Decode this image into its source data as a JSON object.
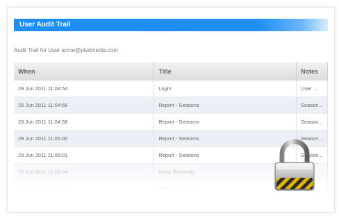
{
  "panel": {
    "title": "User Audit Trail"
  },
  "subtitle": "Audit Trail for User acme@pivdmedia.com",
  "table": {
    "headers": [
      "When",
      "Title",
      "Notes"
    ],
    "rows": [
      [
        "29 Jun 2011 11:04:54",
        "Login",
        "User ..."
      ],
      [
        "29 Jun 2011 11:04:56",
        "Report - Seasons",
        "Season..."
      ],
      [
        "29 Jun 2011 11:04:58",
        "Report - Seasons",
        "Season..."
      ],
      [
        "29 Jun 2011 11:05:00",
        "Report - Seasons",
        "Season..."
      ],
      [
        "29 Jun 2011 11:05:01",
        "Report - Seasons",
        "Season..."
      ],
      [
        "29 Jun 2011 11:05:04",
        "Kiosk Summary",
        ""
      ],
      [
        "29 Jun 2011 11:05:07",
        "Report - User List",
        ""
      ]
    ]
  },
  "icons": {
    "lock": "padlock-icon"
  },
  "colors": {
    "title_bar": "#1e8ef7",
    "row_alt": "#eceff6"
  }
}
